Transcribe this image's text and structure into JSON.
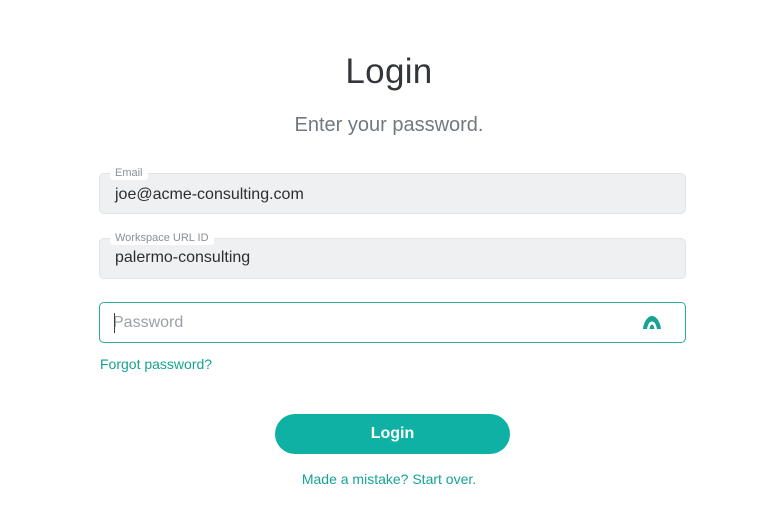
{
  "header": {
    "title": "Login",
    "subtitle": "Enter your password."
  },
  "form": {
    "email": {
      "label": "Email",
      "value": "joe@acme-consulting.com"
    },
    "workspace": {
      "label": "Workspace URL ID",
      "value": "palermo-consulting"
    },
    "password": {
      "placeholder": "Password",
      "value": "",
      "toggle_icon": "eye-toggle-icon"
    },
    "forgot_label": "Forgot password?",
    "submit_label": "Login",
    "start_over_label": "Made a mistake? Start over."
  },
  "colors": {
    "accent": "#0eb1a4",
    "link": "#16a394",
    "readonly_bg": "#eff0f2"
  }
}
